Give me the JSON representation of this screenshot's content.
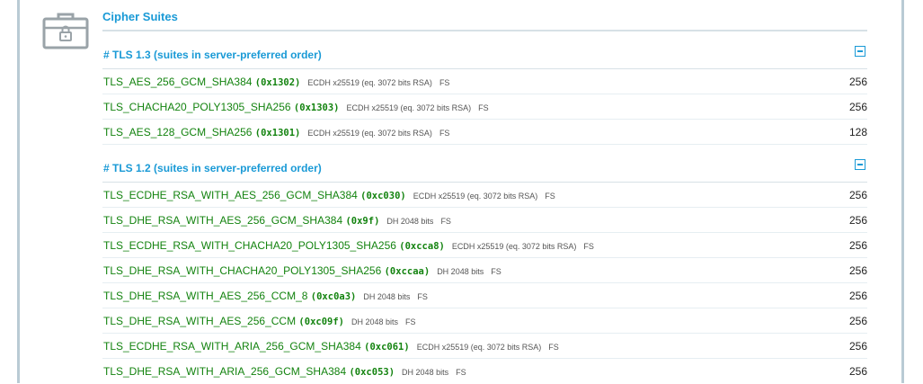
{
  "section": {
    "title": "Cipher Suites",
    "icon": "toolbox-lock-icon"
  },
  "groups": [
    {
      "title": "# TLS 1.3 (suites in server-preferred order)",
      "collapse_icon": "collapse-minus-icon",
      "suites": [
        {
          "name": "TLS_AES_256_GCM_SHA384",
          "code": "(0x1302)",
          "kx": "ECDH x25519 (eq. 3072 bits RSA)",
          "fs": "FS",
          "bits": "256"
        },
        {
          "name": "TLS_CHACHA20_POLY1305_SHA256",
          "code": "(0x1303)",
          "kx": "ECDH x25519 (eq. 3072 bits RSA)",
          "fs": "FS",
          "bits": "256"
        },
        {
          "name": "TLS_AES_128_GCM_SHA256",
          "code": "(0x1301)",
          "kx": "ECDH x25519 (eq. 3072 bits RSA)",
          "fs": "FS",
          "bits": "128"
        }
      ]
    },
    {
      "title": "# TLS 1.2 (suites in server-preferred order)",
      "collapse_icon": "collapse-minus-icon",
      "suites": [
        {
          "name": "TLS_ECDHE_RSA_WITH_AES_256_GCM_SHA384",
          "code": "(0xc030)",
          "kx": "ECDH x25519 (eq. 3072 bits RSA)",
          "fs": "FS",
          "bits": "256"
        },
        {
          "name": "TLS_DHE_RSA_WITH_AES_256_GCM_SHA384",
          "code": "(0x9f)",
          "kx": "DH 2048 bits",
          "fs": "FS",
          "bits": "256"
        },
        {
          "name": "TLS_ECDHE_RSA_WITH_CHACHA20_POLY1305_SHA256",
          "code": "(0xcca8)",
          "kx": "ECDH x25519 (eq. 3072 bits RSA)",
          "fs": "FS",
          "bits": "256"
        },
        {
          "name": "TLS_DHE_RSA_WITH_CHACHA20_POLY1305_SHA256",
          "code": "(0xccaa)",
          "kx": "DH 2048 bits",
          "fs": "FS",
          "bits": "256"
        },
        {
          "name": "TLS_DHE_RSA_WITH_AES_256_CCM_8",
          "code": "(0xc0a3)",
          "kx": "DH 2048 bits",
          "fs": "FS",
          "bits": "256"
        },
        {
          "name": "TLS_DHE_RSA_WITH_AES_256_CCM",
          "code": "(0xc09f)",
          "kx": "DH 2048 bits",
          "fs": "FS",
          "bits": "256"
        },
        {
          "name": "TLS_ECDHE_RSA_WITH_ARIA_256_GCM_SHA384",
          "code": "(0xc061)",
          "kx": "ECDH x25519 (eq. 3072 bits RSA)",
          "fs": "FS",
          "bits": "256"
        },
        {
          "name": "TLS_DHE_RSA_WITH_ARIA_256_GCM_SHA384",
          "code": "(0xc053)",
          "kx": "DH 2048 bits",
          "fs": "FS",
          "bits": "256"
        }
      ]
    }
  ]
}
